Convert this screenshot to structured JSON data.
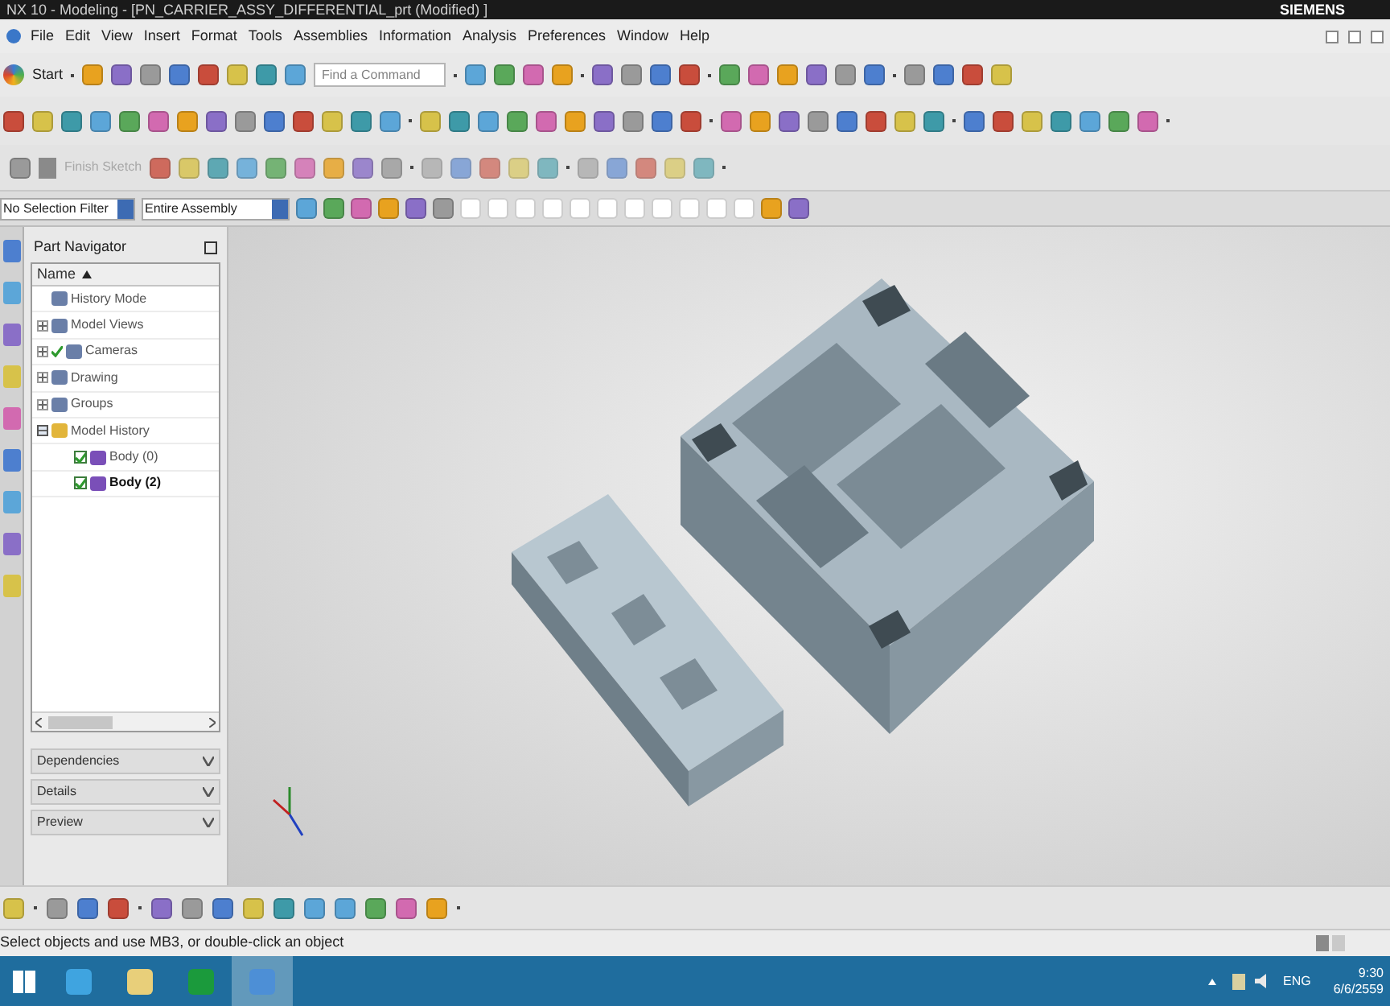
{
  "window": {
    "title": "NX 10 - Modeling - [PN_CARRIER_ASSY_DIFFERENTIAL_prt (Modified) ]",
    "brand": "SIEMENS"
  },
  "menu": [
    "File",
    "Edit",
    "View",
    "Insert",
    "Format",
    "Tools",
    "Assemblies",
    "Information",
    "Analysis",
    "Preferences",
    "Window",
    "Help"
  ],
  "toolbar": {
    "start": "Start",
    "search_placeholder": "Find a Command",
    "finish_sketch": "Finish Sketch"
  },
  "selection_bar": {
    "filter": "No Selection Filter",
    "scope": "Entire Assembly"
  },
  "part_navigator": {
    "title": "Part Navigator",
    "column": "Name",
    "items": [
      {
        "label": "History Mode",
        "expandable": false,
        "checked": false
      },
      {
        "label": "Model Views",
        "expandable": true,
        "expanded": false,
        "checked": false
      },
      {
        "label": "Cameras",
        "expandable": true,
        "expanded": false,
        "checked": true
      },
      {
        "label": "Drawing",
        "expandable": true,
        "expanded": false,
        "checked": false
      },
      {
        "label": "Groups",
        "expandable": true,
        "expanded": false,
        "checked": false
      },
      {
        "label": "Model History",
        "expandable": true,
        "expanded": true,
        "checked": false,
        "children": [
          {
            "label": "Body (0)",
            "checked": true,
            "current": false
          },
          {
            "label": "Body (2)",
            "checked": true,
            "current": true
          }
        ]
      }
    ]
  },
  "panels": [
    "Dependencies",
    "Details",
    "Preview"
  ],
  "status_bar": {
    "message": "Select objects and use MB3, or double-click an object"
  },
  "taskbar": {
    "apps": [
      {
        "selected": false
      },
      {
        "selected": false
      },
      {
        "selected": false
      },
      {
        "selected": true
      }
    ],
    "language": "ENG",
    "time": "9:30",
    "date": "6/6/2559"
  }
}
